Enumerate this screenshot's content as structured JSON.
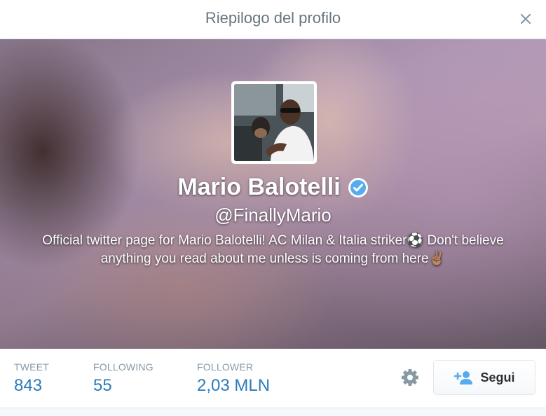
{
  "header": {
    "title": "Riepilogo del profilo",
    "close_symbol": "×"
  },
  "profile": {
    "name": "Mario Balotelli",
    "verified": true,
    "handle": "@FinallyMario",
    "bio": "Official twitter page for Mario Balotelli! AC Milan & Italia striker⚽ Don't believe anything you read about me unless is coming from here✌🏽"
  },
  "stats": {
    "tweet": {
      "label": "TWEET",
      "value": "843"
    },
    "following": {
      "label": "FOLLOWING",
      "value": "55"
    },
    "follower": {
      "label": "FOLLOWER",
      "value": "2,03 MLN"
    }
  },
  "actions": {
    "settings_icon": "gear-icon",
    "follow_label": "Segui",
    "follow_icon": "add-user-icon"
  },
  "colors": {
    "link_blue": "#2b7bb9",
    "muted": "#8899a6",
    "verified_blue": "#55acee"
  }
}
